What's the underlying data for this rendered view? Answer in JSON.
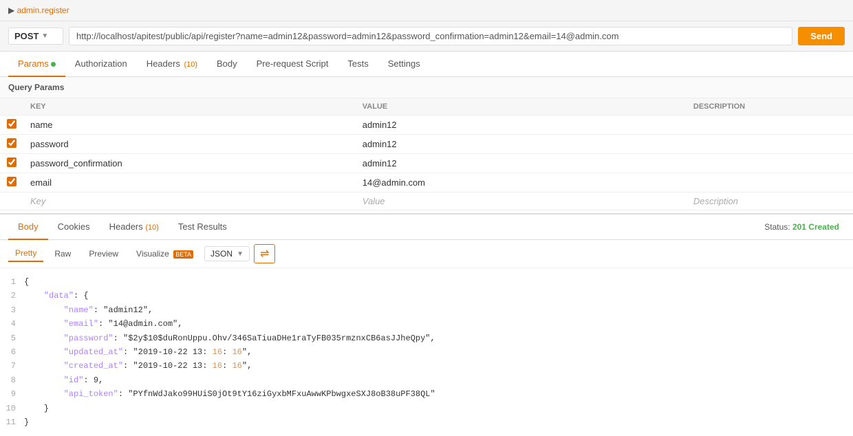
{
  "breadcrumb": {
    "text": "admin.register"
  },
  "url_bar": {
    "method": "POST",
    "url": "http://localhost/apitest/public/api/register?name=admin12&password=admin12&password_confirmation=admin12&email=14@admin.com",
    "send_label": "Send"
  },
  "request_tabs": [
    {
      "id": "params",
      "label": "Params",
      "dot": true,
      "badge": null,
      "active": true
    },
    {
      "id": "authorization",
      "label": "Authorization",
      "dot": false,
      "badge": null,
      "active": false
    },
    {
      "id": "headers",
      "label": "Headers",
      "dot": false,
      "badge": "(10)",
      "active": false
    },
    {
      "id": "body",
      "label": "Body",
      "dot": false,
      "badge": null,
      "active": false
    },
    {
      "id": "prerequest",
      "label": "Pre-request Script",
      "dot": false,
      "badge": null,
      "active": false
    },
    {
      "id": "tests",
      "label": "Tests",
      "dot": false,
      "badge": null,
      "active": false
    },
    {
      "id": "settings",
      "label": "Settings",
      "dot": false,
      "badge": null,
      "active": false
    }
  ],
  "query_params": {
    "section_label": "Query Params",
    "columns": [
      "KEY",
      "VALUE",
      "DESCRIPTION"
    ],
    "rows": [
      {
        "checked": true,
        "key": "name",
        "value": "admin12",
        "description": ""
      },
      {
        "checked": true,
        "key": "password",
        "value": "admin12",
        "description": ""
      },
      {
        "checked": true,
        "key": "password_confirmation",
        "value": "admin12",
        "description": ""
      },
      {
        "checked": true,
        "key": "email",
        "value": "14@admin.com",
        "description": ""
      }
    ],
    "placeholder_key": "Key",
    "placeholder_value": "Value",
    "placeholder_description": "Description"
  },
  "response_tabs": [
    {
      "id": "body",
      "label": "Body",
      "badge": null,
      "active": true
    },
    {
      "id": "cookies",
      "label": "Cookies",
      "badge": null,
      "active": false
    },
    {
      "id": "headers",
      "label": "Headers",
      "badge": "(10)",
      "active": false
    },
    {
      "id": "test_results",
      "label": "Test Results",
      "badge": null,
      "active": false
    }
  ],
  "status": {
    "label": "Status:",
    "value": "201 Created"
  },
  "format_bar": {
    "pretty_label": "Pretty",
    "raw_label": "Raw",
    "preview_label": "Preview",
    "visualize_label": "Visualize",
    "visualize_badge": "BETA",
    "json_label": "JSON"
  },
  "response_json": {
    "lines": [
      {
        "num": 1,
        "content": "{"
      },
      {
        "num": 2,
        "content": "    \"data\": {"
      },
      {
        "num": 3,
        "content": "        \"name\": \"admin12\","
      },
      {
        "num": 4,
        "content": "        \"email\": \"14@admin.com\","
      },
      {
        "num": 5,
        "content": "        \"password\": \"$2y$10$duRonUppu.Ohv/346SaTiuaDHe1raTyFB035rmznxCB6asJJheQpy\","
      },
      {
        "num": 6,
        "content": "        \"updated_at\": \"2019-10-22 13:16:16\","
      },
      {
        "num": 7,
        "content": "        \"created_at\": \"2019-10-22 13:16:16\","
      },
      {
        "num": 8,
        "content": "        \"id\": 9,"
      },
      {
        "num": 9,
        "content": "        \"api_token\": \"PYfnWdJako99HUiS0jOt9tY16ziGyxbMFxuAwwKPbwgxeSXJ8oB38uPF38QL\""
      },
      {
        "num": 10,
        "content": "    }"
      },
      {
        "num": 11,
        "content": "}"
      }
    ]
  }
}
